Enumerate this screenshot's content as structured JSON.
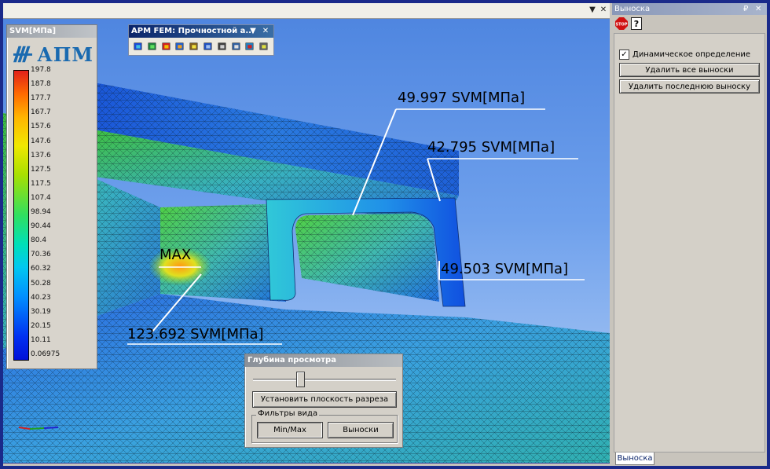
{
  "document": {
    "controls": [
      "▼",
      "✕"
    ]
  },
  "legend": {
    "title": "SVM[МПа]",
    "logo_text": "АПМ",
    "ticks": [
      "197.8",
      "187.8",
      "177.7",
      "167.7",
      "157.6",
      "147.6",
      "137.6",
      "127.5",
      "117.5",
      "107.4",
      "98.94",
      "90.44",
      "80.4",
      "70.36",
      "60.32",
      "50.28",
      "40.23",
      "30.19",
      "20.15",
      "10.11",
      "0.06975"
    ]
  },
  "fem_toolbar": {
    "title": "APM FEM: Прочностной а...",
    "icons": [
      "scale-icon",
      "mesh-icon",
      "results-icon",
      "cube-icon",
      "deform-icon",
      "wave-icon",
      "graph-icon",
      "model-icon",
      "table-icon",
      "settings-icon"
    ]
  },
  "callouts": {
    "c1": "49.997 SVM[МПа]",
    "c2": "42.795 SVM[МПа]",
    "c3": "49.503 SVM[МПа]",
    "c4": "123.692 SVM[МПа]",
    "max": "MAX"
  },
  "depth_dialog": {
    "title": "Глубина просмотра",
    "set_plane_button": "Установить плоскость разреза",
    "filters_label": "Фильтры вида",
    "minmax_button": "Min/Max",
    "callouts_button": "Выноски",
    "slider_value": 0.35
  },
  "right_panel": {
    "title": "Выноска",
    "pin": "₽",
    "close": "✕",
    "dynamic_label": "Динамическое определение",
    "dynamic_checked": "✓",
    "delete_all_button": "Удалить все выноски",
    "delete_last_button": "Удалить последнюю выноску",
    "tab_label": "Выноска"
  },
  "colors": {
    "viewport_top": "#4f86e0",
    "title_active": "#0a246a",
    "logo_blue": "#1a6ab0"
  }
}
